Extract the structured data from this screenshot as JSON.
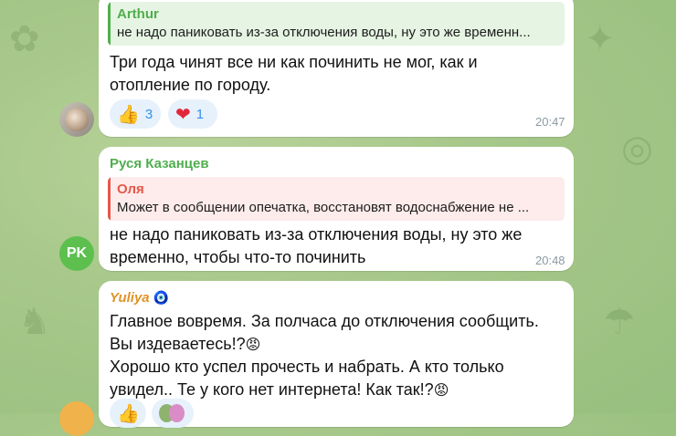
{
  "messages": [
    {
      "reply": {
        "name": "Arthur",
        "text": "не надо паниковать из-за отключения воды, ну это же временн..."
      },
      "lines": [
        "Три года чинят все ни как починить не мог, как и",
        "отопление по городу."
      ],
      "reactions": [
        {
          "emoji": "👍",
          "icon": "thumbs-up-icon",
          "count": "3"
        },
        {
          "emoji": "❤",
          "icon": "heart-icon",
          "count": "1"
        }
      ],
      "time": "20:47"
    },
    {
      "sender": "Руся Казанцев",
      "avatar_initials": "PK",
      "reply": {
        "name": "Оля",
        "text": "Может в сообщении опечатка, восстановят водоснабжение не ..."
      },
      "lines": [
        "не надо паниковать из-за отключения воды, ну это же",
        "временно, чтобы что-то починить"
      ],
      "time": "20:48"
    },
    {
      "sender": "Yuliya",
      "sender_badge": "🧿",
      "lines": [
        "Главное вовремя. За полчаса до отключения сообщить.",
        "Вы издеваетесь!?",
        "Хорошо кто успел прочесть и набрать. А кто только",
        "увидел..  Те у кого нет интернета! Как так!?"
      ],
      "angry_emoji": "😡"
    }
  ],
  "colors": {
    "arthur": "#4fae4e",
    "olya": "#e5584a",
    "rusya": "#4fae4e",
    "yuliya": "#e0932a",
    "link": "#3390ec"
  }
}
